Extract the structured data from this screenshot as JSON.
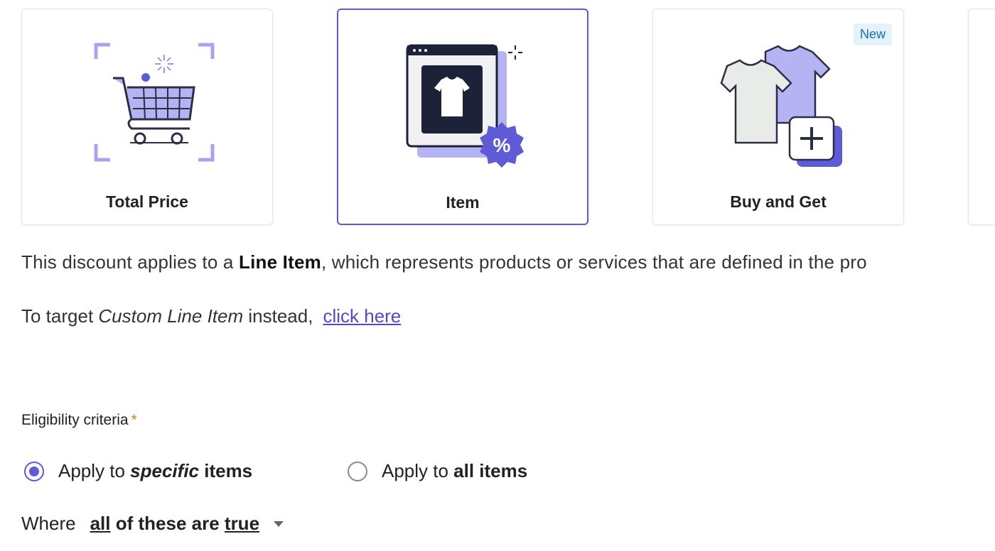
{
  "cards": [
    {
      "label": "Total Price"
    },
    {
      "label": "Item"
    },
    {
      "label": "Buy and Get",
      "badge": "New"
    }
  ],
  "description": {
    "prefix": "This discount applies to a ",
    "bold": "Line Item",
    "suffix": ", which represents products or services that are defined in the pro"
  },
  "target": {
    "prefix": "To target ",
    "italic": "Custom Line Item",
    "middle": " instead,",
    "link": "click here"
  },
  "eligibility": {
    "label": "Eligibility criteria",
    "required_marker": "*",
    "options": [
      {
        "pre": "Apply to ",
        "italic": "specific",
        "post": " items",
        "checked": true
      },
      {
        "pre": "Apply to ",
        "bold": "all items",
        "checked": false
      }
    ]
  },
  "where": {
    "label": "Where",
    "selector_a": "all",
    "selector_b": " of these are ",
    "selector_c": "true"
  },
  "colors": {
    "accent": "#5f5bd6",
    "icon_light": "#a8a4f0",
    "icon_dark": "#1c2238",
    "badge_bg": "#e4f2fb"
  }
}
